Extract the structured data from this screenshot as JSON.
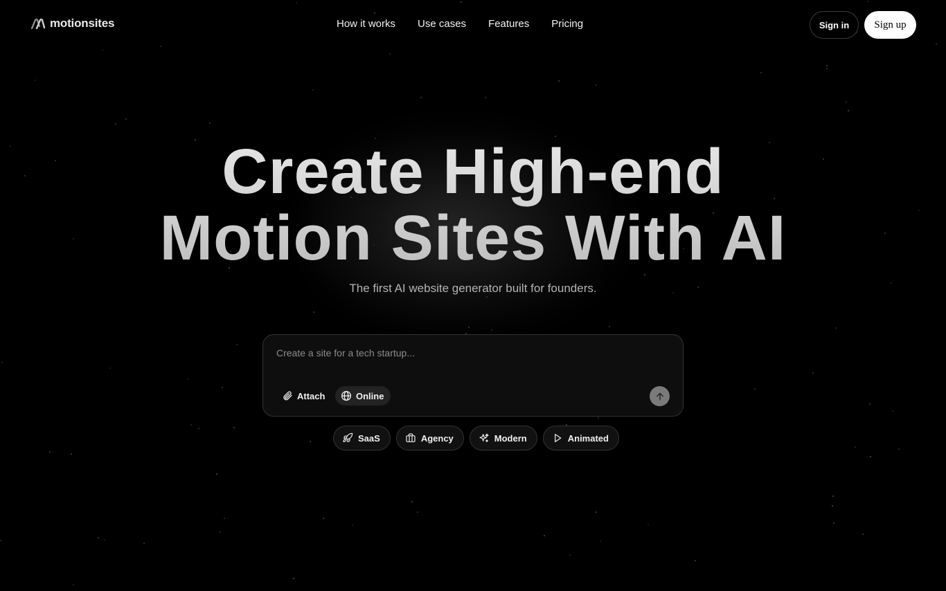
{
  "header": {
    "logo_text": "motionsites",
    "nav": [
      {
        "label": "How it works"
      },
      {
        "label": "Use cases"
      },
      {
        "label": "Features"
      },
      {
        "label": "Pricing"
      }
    ],
    "sign_in_label": "Sign in",
    "sign_up_label": "Sign up"
  },
  "hero": {
    "title_line1": "Create High-end",
    "title_line2": "Motion Sites With AI",
    "subtitle": "The first AI website generator built for founders."
  },
  "prompt": {
    "placeholder": "Create a site for a tech startup...",
    "value": "",
    "attach_label": "Attach",
    "attach_icon": "paperclip-icon",
    "online_label": "Online",
    "online_icon": "globe-icon",
    "send_icon": "arrow-up-icon"
  },
  "chips": [
    {
      "label": "SaaS",
      "icon": "rocket-icon"
    },
    {
      "label": "Agency",
      "icon": "briefcase-icon"
    },
    {
      "label": "Modern",
      "icon": "sparkles-icon"
    },
    {
      "label": "Animated",
      "icon": "play-icon"
    }
  ],
  "colors": {
    "background": "#000000",
    "title": "#d6d6d6",
    "subtitle": "#b4b4b4",
    "signup_bg": "#ffffff",
    "send_button": "#7a7a7a"
  }
}
